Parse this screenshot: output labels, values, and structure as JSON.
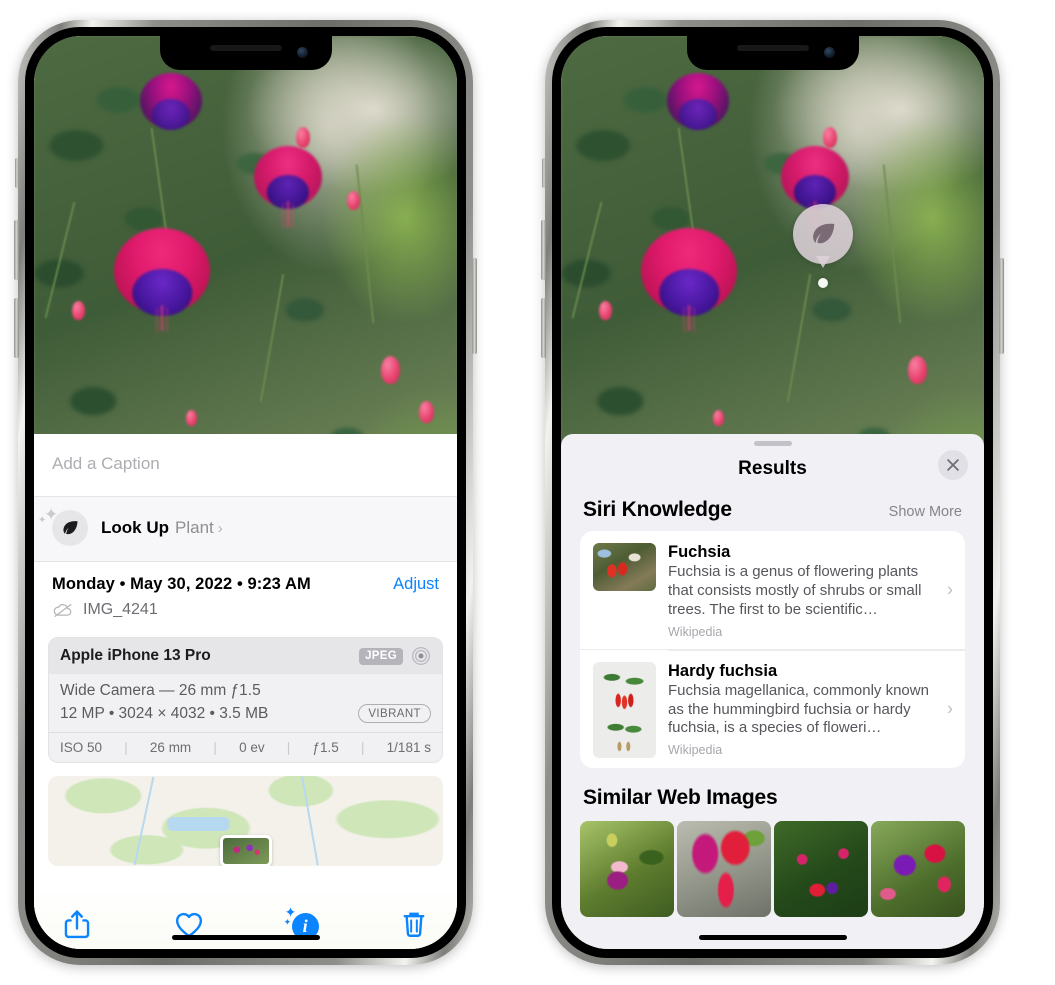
{
  "left_phone": {
    "caption_placeholder": "Add a Caption",
    "lookup": {
      "title": "Look Up",
      "dash": " – ",
      "subject": "Plant",
      "chevron": "›",
      "icon": "leaf-icon"
    },
    "metadata": {
      "date_line": "Monday • May 30, 2022 • 9:23 AM",
      "adjust_label": "Adjust",
      "filename": "IMG_4241",
      "cloud_icon": "no-cloud-icon"
    },
    "camera_card": {
      "model": "Apple iPhone 13 Pro",
      "format_badge": "JPEG",
      "aperture_icon": "aperture-icon",
      "lens_line": "Wide Camera — 26 mm ƒ1.5",
      "size_line": "12 MP • 3024 × 4032 • 3.5 MB",
      "style_badge": "VIBRANT",
      "exif": [
        "ISO 50",
        "26 mm",
        "0 ev",
        "ƒ1.5",
        "1/181 s"
      ],
      "exif_separator": "|"
    },
    "toolbar": {
      "share_label": "share-icon",
      "favorite_label": "heart-icon",
      "info_label": "info-sparkle-icon",
      "info_glyph": "i",
      "delete_label": "trash-icon"
    }
  },
  "right_phone": {
    "pin": {
      "icon": "leaf-icon"
    },
    "sheet": {
      "title": "Results",
      "close_icon": "close-icon"
    },
    "siri_knowledge": {
      "section_title": "Siri Knowledge",
      "action_label": "Show More",
      "cards": [
        {
          "title": "Fuchsia",
          "description": "Fuchsia is a genus of flowering plants that consists mostly of shrubs or small trees. The first to be scientific…",
          "source": "Wikipedia",
          "chevron": "›"
        },
        {
          "title": "Hardy fuchsia",
          "description": "Fuchsia magellanica, commonly known as the hummingbird fuchsia or hardy fuchsia, is a species of floweri…",
          "source": "Wikipedia",
          "chevron": "›"
        }
      ]
    },
    "similar_web_images": {
      "section_title": "Similar Web Images",
      "tiles": [
        "fuchsia-thumb-1",
        "fuchsia-thumb-2",
        "fuchsia-thumb-3",
        "fuchsia-thumb-4"
      ]
    }
  },
  "colors": {
    "accent_blue": "#0b84ff",
    "sheet_gray": "#f1f0f5",
    "card_white": "#ffffff",
    "secondary_text": "#8e8e93"
  }
}
